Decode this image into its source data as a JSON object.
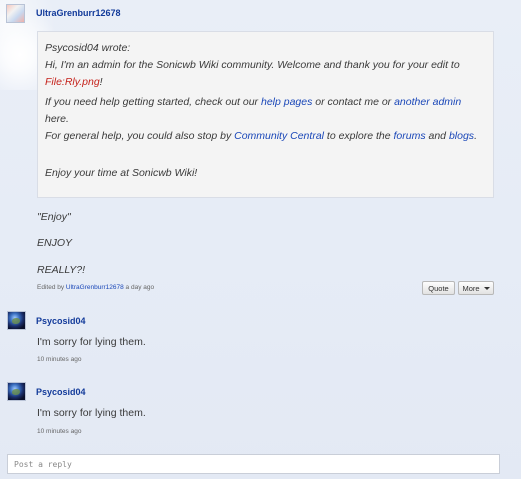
{
  "thread": {
    "first_post": {
      "author": "UltraGrenburr12678",
      "quote": {
        "header": "Psycosid04 wrote:",
        "line1_pre": "Hi, I'm an admin for the Sonicwb Wiki community. Welcome and thank you for your edit to",
        "line2_link": "File:Rly.png",
        "line2_post": "!",
        "line3_pre": "If you need help getting started, check out our",
        "line3_link1": "help pages",
        "line3_mid": "or contact me or",
        "line3_link2": "another admin",
        "line3_post": "here.",
        "line4_pre": "For general help, you could also stop by",
        "line4_link1": "Community Central",
        "line4_mid1": "to explore the",
        "line4_link2": "forums",
        "line4_mid2": "and",
        "line4_link3": "blogs",
        "line4_post": ".",
        "line5": "Enjoy your time at Sonicwb Wiki!"
      },
      "lines": [
        "\"Enjoy\"",
        "ENJOY",
        "REALLY?!"
      ],
      "meta_prefix": "Edited by",
      "meta_author": "UltraGrenburr12678",
      "meta_time": "a day ago",
      "quote_button": "Quote",
      "more_button": "More"
    },
    "replies": [
      {
        "author": "Psycosid04",
        "text": "I'm sorry for lying them.",
        "time": "10 minutes ago"
      },
      {
        "author": "Psycosid04",
        "text": "I'm sorry for lying them.",
        "time": "10 minutes ago"
      }
    ],
    "reply_placeholder": "Post a reply"
  }
}
